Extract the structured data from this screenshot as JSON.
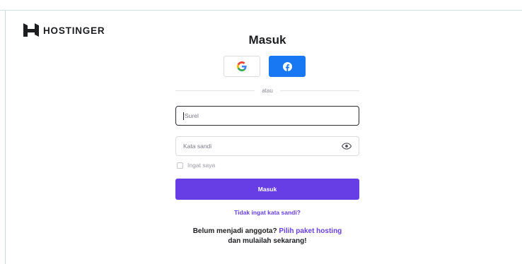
{
  "brand": {
    "name": "HOSTINGER"
  },
  "form": {
    "title": "Masuk",
    "social": [
      {
        "name": "google",
        "label": "G",
        "icon": "google-icon"
      },
      {
        "name": "facebook",
        "label": "f",
        "icon": "facebook-icon",
        "color": "#1877f2"
      }
    ],
    "divider_text": "atau",
    "email_placeholder": "Surel",
    "password_placeholder": "Kata sandi",
    "remember_label": "Ingat saya",
    "submit_label": "Masuk",
    "forgot_link": "Tidak ingat kata sandi?",
    "signup_prefix": "Belum menjadi anggota?",
    "signup_link": "Pilih paket hosting",
    "signup_suffix": "dan mulailah sekarang!"
  },
  "colors": {
    "accent": "#673de6",
    "facebook": "#1877f2",
    "text": "#1d1e20"
  }
}
